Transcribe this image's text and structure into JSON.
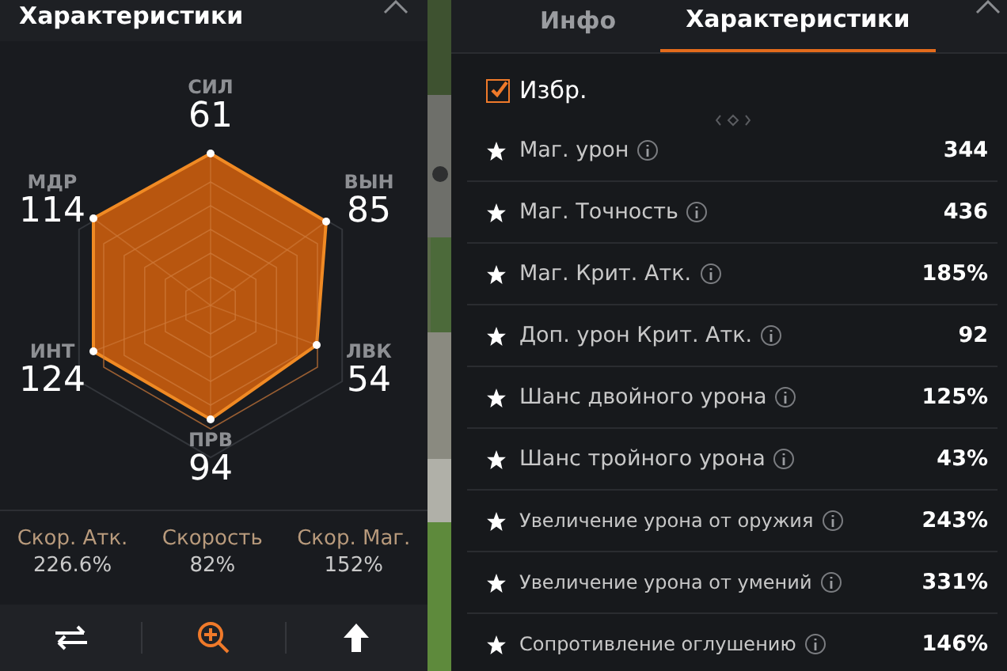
{
  "left_panel": {
    "title": "Характеристики",
    "stats": [
      {
        "name": "СИЛ",
        "value": "61"
      },
      {
        "name": "МДР",
        "value": "114"
      },
      {
        "name": "ВЫН",
        "value": "85"
      },
      {
        "name": "ИНТ",
        "value": "124"
      },
      {
        "name": "ЛВК",
        "value": "54"
      },
      {
        "name": "ПРВ",
        "value": "94"
      }
    ],
    "speeds": [
      {
        "label": "Скор. Атк.",
        "value": "226.6%"
      },
      {
        "label": "Скорость",
        "value": "82%"
      },
      {
        "label": "Скор. Маг.",
        "value": "152%"
      }
    ],
    "toolbar": [
      {
        "kind": "swap",
        "active": false
      },
      {
        "kind": "zoom",
        "active": true
      },
      {
        "kind": "up",
        "active": false
      }
    ]
  },
  "right_panel": {
    "tabs": [
      {
        "label": "Инфо",
        "selected": false
      },
      {
        "label": "Характеристики",
        "selected": true
      }
    ],
    "favorites": {
      "label": "Избр.",
      "checked": true
    },
    "rows": [
      {
        "label": "Маг. урон",
        "value": "344",
        "small": false
      },
      {
        "label": "Маг. Точность",
        "value": "436",
        "small": false
      },
      {
        "label": "Маг. Крит. Атк.",
        "value": "185%",
        "small": false
      },
      {
        "label": "Доп. урон Крит. Атк.",
        "value": "92",
        "small": false
      },
      {
        "label": "Шанс двойного урона",
        "value": "125%",
        "small": false
      },
      {
        "label": "Шанс тройного урона",
        "value": "43%",
        "small": false
      },
      {
        "label": "Увеличение урона от оружия",
        "value": "243%",
        "small": true
      },
      {
        "label": "Увеличение урона от умений",
        "value": "331%",
        "small": true
      },
      {
        "label": "Сопротивление оглушению",
        "value": "146%",
        "small": true
      }
    ]
  }
}
